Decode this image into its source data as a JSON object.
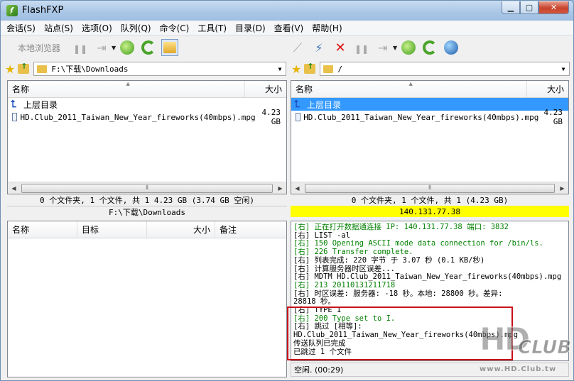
{
  "window": {
    "title": "FlashFXP"
  },
  "menu": [
    "会话(S)",
    "站点(S)",
    "选项(O)",
    "队列(Q)",
    "命令(C)",
    "工具(T)",
    "目录(D)",
    "查看(V)",
    "帮助(H)"
  ],
  "toolbar_left": {
    "local_browser_label": "本地浏览器"
  },
  "local": {
    "path": "F:\\下载\\Downloads",
    "columns": {
      "name": "名称",
      "size": "大小"
    },
    "up_label": "上层目录",
    "files": [
      {
        "name": "HD.Club_2011_Taiwan_New_Year_fireworks(40mbps).mpg",
        "size": "4.23 GB"
      }
    ],
    "summary": "0 个文件夹, 1 个文件, 共 1 4.23 GB (3.74 GB 空闲)",
    "current_path": "F:\\下载\\Downloads"
  },
  "remote": {
    "path": "/",
    "columns": {
      "name": "名称",
      "size": "大小"
    },
    "up_label": "上层目录",
    "files": [
      {
        "name": "HD.Club_2011_Taiwan_New_Year_fireworks(40mbps).mpg",
        "size": "4.23 GB"
      }
    ],
    "summary": "0 个文件夹, 1 个文件, 共 1 (4.23 GB)",
    "server": "140.131.77.38"
  },
  "queue": {
    "columns": {
      "name": "名称",
      "target": "目标",
      "size": "大小",
      "note": "备注"
    }
  },
  "log": [
    {
      "text": "[右] 正在打开数据通连接 IP: 140.131.77.38 端口: 3832",
      "color": "green"
    },
    {
      "text": "[右] LIST -al",
      "color": "black"
    },
    {
      "text": "[右] 150 Opening ASCII mode data connection for /bin/ls.",
      "color": "green"
    },
    {
      "text": "[右] 226 Transfer complete.",
      "color": "green"
    },
    {
      "text": "[右] 列表完成: 220 字节 于 3.07 秒 (0.1 KB/秒)",
      "color": "black"
    },
    {
      "text": "[右] 计算服务器时区误差...",
      "color": "black"
    },
    {
      "text": "[右] MDTM HD.Club_2011_Taiwan_New_Year_fireworks(40mbps).mpg",
      "color": "black"
    },
    {
      "text": "[右] 213 20110131211718",
      "color": "green"
    },
    {
      "text": "[右] 时区误差: 服务器: -18 秒。本地: 28800 秒。差异:",
      "color": "black"
    },
    {
      "text": "28818 秒。",
      "color": "black"
    },
    {
      "text": "[右] TYPE I",
      "color": "black"
    },
    {
      "text": "[右] 200 Type set to I.",
      "color": "green"
    },
    {
      "text": "[右] 跳过 [相等]:",
      "color": "black"
    },
    {
      "text": "HD.Club_2011_Taiwan_New_Year_fireworks(40mbps).mpg",
      "color": "black"
    },
    {
      "text": "传送队列已完成",
      "color": "black"
    },
    {
      "text": "已跳过 1 个文件",
      "color": "black"
    }
  ],
  "status": {
    "text": "空闲. (00:29)"
  },
  "watermark": {
    "big": "HD",
    "club": "CLUB",
    "url": "www.HD.Club.tw"
  }
}
